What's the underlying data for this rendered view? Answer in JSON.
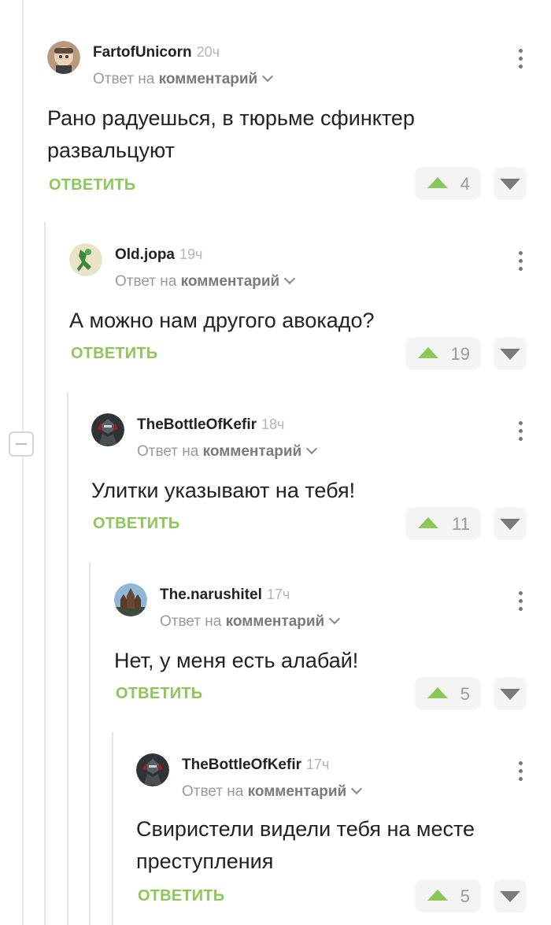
{
  "comments": [
    {
      "author": "FartofUnicorn",
      "time": "20ч",
      "reply_prefix": "Ответ на",
      "reply_target": "комментарий",
      "text_lines": [
        "Рано радуешься, в тюрьме сфинктер",
        "развальцуют"
      ],
      "reply_label": "ОТВЕТИТЬ",
      "votes": "4",
      "avatar_icon": "cartoon-face-avatar"
    },
    {
      "author": "Old.jopa",
      "time": "19ч",
      "reply_prefix": "Ответ на",
      "reply_target": "комментарий",
      "text_lines": [
        "А можно нам другого авокадо?"
      ],
      "reply_label": "ОТВЕТИТЬ",
      "votes": "19",
      "avatar_icon": "green-figure-avatar"
    },
    {
      "author": "TheBottleOfKefir",
      "time": "18ч",
      "reply_prefix": "Ответ на",
      "reply_target": "комментарий",
      "text_lines": [
        "Улитки указывают на тебя!"
      ],
      "reply_label": "ОТВЕТИТЬ",
      "votes": "11",
      "avatar_icon": "dark-knight-avatar"
    },
    {
      "author": "The.narushitel",
      "time": "17ч",
      "reply_prefix": "Ответ на",
      "reply_target": "комментарий",
      "text_lines": [
        "Нет, у меня есть алабай!"
      ],
      "reply_label": "ОТВЕТИТЬ",
      "votes": "5",
      "avatar_icon": "castle-avatar"
    },
    {
      "author": "TheBottleOfKefir",
      "time": "17ч",
      "reply_prefix": "Ответ на",
      "reply_target": "комментарий",
      "text_lines": [
        "Свиристели видели тебя на месте",
        "преступления"
      ],
      "reply_label": "ОТВЕТИТЬ",
      "votes": "5",
      "avatar_icon": "dark-knight-avatar"
    }
  ],
  "colors": {
    "accent_green": "#8ac858",
    "text": "#222222",
    "muted": "#9a9a9a",
    "thread_line": "#e6e6e6"
  }
}
